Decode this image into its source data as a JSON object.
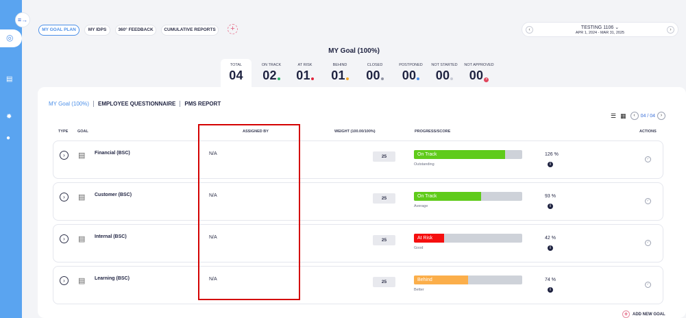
{
  "nav": {
    "tabs": [
      {
        "label": "MY GOAL PLAN",
        "active": true
      },
      {
        "label": "MY IDPS"
      },
      {
        "label": "360° FEEDBACK"
      },
      {
        "label": "CUMULATIVE REPORTS"
      }
    ],
    "add_icon": "plus-icon"
  },
  "period": {
    "title": "TESTING 1106",
    "range": "APR 1, 2024 - MAR 31, 2025"
  },
  "header": {
    "title": "MY Goal (100%)"
  },
  "stats": [
    {
      "label": "TOTAL",
      "value": "04"
    },
    {
      "label": "ON TRACK",
      "value": "02",
      "dot": "#2fb36b"
    },
    {
      "label": "AT RISK",
      "value": "01",
      "dot": "#e0233a"
    },
    {
      "label": "BEHIND",
      "value": "01",
      "dot": "#f5a623"
    },
    {
      "label": "CLOSED",
      "value": "00",
      "dot": "#8f93a3"
    },
    {
      "label": "POSTPONED",
      "value": "00",
      "dot": "#4b8fe8"
    },
    {
      "label": "NOT STARTED",
      "value": "00",
      "dot": "#c7cad4"
    },
    {
      "label": "NOT APPROVED",
      "value": "00",
      "dot": "#e0455b"
    }
  ],
  "subtabs": [
    {
      "label": "MY Goal (100%)",
      "active": true
    },
    {
      "label": "EMPLOYEE QUESTIONNAIRE"
    },
    {
      "label": "PMS REPORT"
    }
  ],
  "pagination": {
    "text": "04 / 04"
  },
  "columns": {
    "type": "TYPE",
    "goal": "GOAL",
    "assigned": "ASSIGNED BY",
    "weight": "WEIGHT (100.00/100%)",
    "progress": "PROGRESS/SCORE",
    "actions": "ACTIONS"
  },
  "rows": [
    {
      "goal": "Financial (BSC)",
      "assigned": "N/A",
      "weight": "25",
      "status": "On Track",
      "progress": 0.84,
      "color": "#5fcb1a",
      "rating": "Outstanding",
      "score": "126",
      "pct_sign": "%"
    },
    {
      "goal": "Customer (BSC)",
      "assigned": "N/A",
      "weight": "25",
      "status": "On Track",
      "progress": 0.62,
      "color": "#5fcb1a",
      "rating": "Average",
      "score": "93",
      "pct_sign": "%"
    },
    {
      "goal": "Internal (BSC)",
      "assigned": "N/A",
      "weight": "25",
      "status": "At Risk",
      "progress": 0.28,
      "color": "#f50f0f",
      "rating": "Good",
      "score": "42",
      "pct_sign": "%"
    },
    {
      "goal": "Learning (BSC)",
      "assigned": "N/A",
      "weight": "25",
      "status": "Behind",
      "progress": 0.5,
      "color": "#fbae4a",
      "rating": "Better",
      "score": "74",
      "pct_sign": "%"
    }
  ],
  "footer": {
    "add_goal": "ADD NEW GOAL"
  }
}
